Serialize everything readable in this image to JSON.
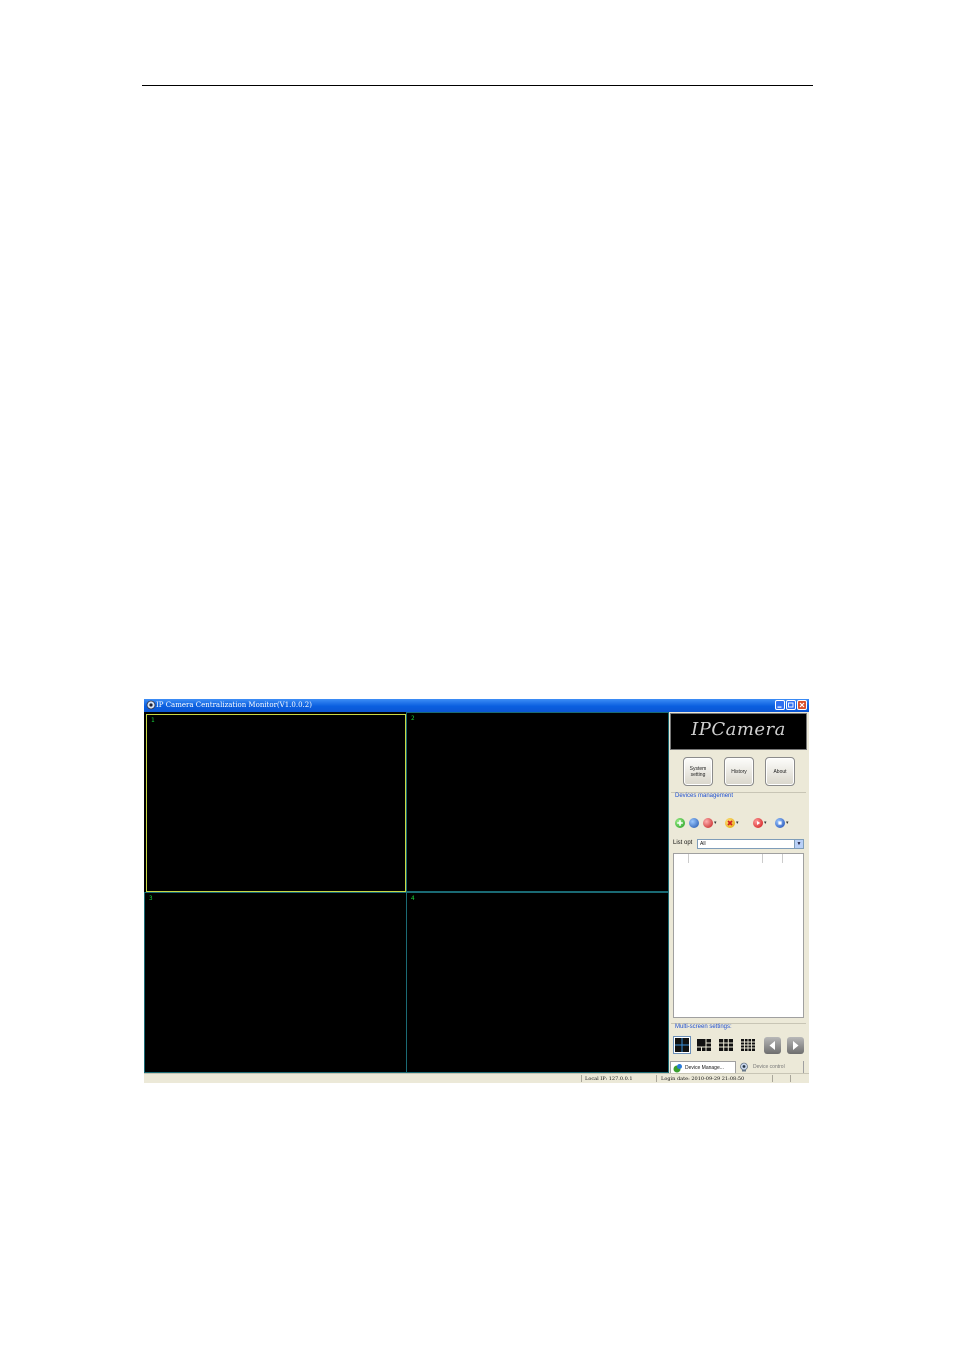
{
  "window": {
    "title": "IP Camera Centralization Monitor(V1.0.0.2)"
  },
  "video": {
    "panes": [
      {
        "number": "1",
        "selected": true
      },
      {
        "number": "2",
        "selected": false
      },
      {
        "number": "3",
        "selected": false
      },
      {
        "number": "4",
        "selected": false
      }
    ]
  },
  "panel": {
    "logo": "IPCamera",
    "buttons": {
      "system_setting": "System setting",
      "history": "History",
      "about": "About"
    },
    "devices_management": "Devices management",
    "toolbar_icons": [
      "add-device-icon",
      "search-device-icon",
      "edit-device-icon",
      "delete-device-icon",
      "play-icon",
      "stop-icon"
    ],
    "list_opt_label": "List opt",
    "list_opt_value": "All",
    "multi_screen_label": "Multi-screen settings:",
    "layouts": [
      "layout-4-icon",
      "layout-6-icon",
      "layout-9-icon",
      "layout-16-icon"
    ],
    "tabs": {
      "device_manage": "Device Manage...",
      "device_control": "Device control"
    }
  },
  "status": {
    "local_ip": "Local IP: 127.0.0.1",
    "login_date": "Login date: 2010-09-29 21:08:50"
  },
  "colors": {
    "title_bar": "#0a5fe0",
    "selected_pane_border": "#c9d845",
    "pane_border": "#1a6a74",
    "pane_number": "#19d33b",
    "section_label": "#1e4fd0"
  }
}
